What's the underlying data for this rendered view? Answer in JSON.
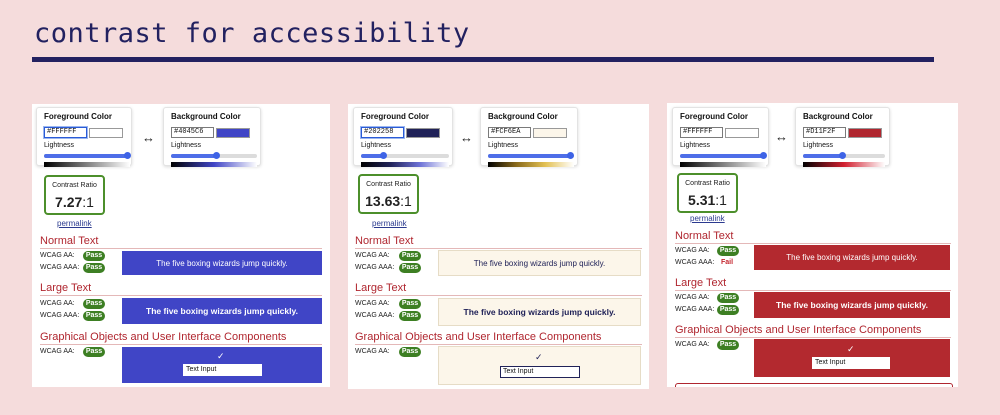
{
  "page": {
    "title": "contrast for accessibility"
  },
  "panels": [
    {
      "foreground": {
        "title": "Foreground Color",
        "hex": "#FFFFFF",
        "swatch": "#FFFFFF",
        "lightness_label": "Lightness",
        "lightness": 0.96
      },
      "background": {
        "title": "Background Color",
        "hex": "#4045C6",
        "swatch": "#4045C6",
        "lightness_label": "Lightness",
        "lightness": 0.52
      },
      "swap_symbol": "↔",
      "contrast": {
        "label": "Contrast Ratio",
        "value": "7.27",
        "suffix": ":1"
      },
      "permalink": "permalink",
      "normal": {
        "heading": "Normal Text",
        "aa_label": "WCAG AA:",
        "aa": "Pass",
        "aaa_label": "WCAG AAA:",
        "aaa": "Pass",
        "sample": "The five boxing wizards jump quickly."
      },
      "large": {
        "heading": "Large Text",
        "aa_label": "WCAG AA:",
        "aa": "Pass",
        "aaa_label": "WCAG AAA:",
        "aaa": "Pass",
        "sample": "The five boxing wizards jump quickly."
      },
      "graphics": {
        "heading": "Graphical Objects and User Interface Components",
        "aa_label": "WCAG AA:",
        "aa": "Pass",
        "check": "✓",
        "input_value": "Text Input"
      },
      "colors": {
        "sample_bg": "#4045C6",
        "sample_fg": "#FFFFFF",
        "input_border": "#FFFFFF",
        "grad_fg_start": "#FFFFFF",
        "grad_fg_end": "#000000"
      }
    },
    {
      "foreground": {
        "title": "Foreground Color",
        "hex": "#202258",
        "swatch": "#202258",
        "lightness_label": "Lightness",
        "lightness": 0.25
      },
      "background": {
        "title": "Background Color",
        "hex": "#FCF6EA",
        "swatch": "#FCF6EA",
        "lightness_label": "Lightness",
        "lightness": 0.95
      },
      "swap_symbol": "↔",
      "contrast": {
        "label": "Contrast Ratio",
        "value": "13.63",
        "suffix": ":1"
      },
      "permalink": "permalink",
      "normal": {
        "heading": "Normal Text",
        "aa_label": "WCAG AA:",
        "aa": "Pass",
        "aaa_label": "WCAG AAA:",
        "aaa": "Pass",
        "sample": "The five boxing wizards jump quickly."
      },
      "large": {
        "heading": "Large Text",
        "aa_label": "WCAG AA:",
        "aa": "Pass",
        "aaa_label": "WCAG AAA:",
        "aaa": "Pass",
        "sample": "The five boxing wizards jump quickly."
      },
      "graphics": {
        "heading": "Graphical Objects and User Interface Components",
        "aa_label": "WCAG AA:",
        "aa": "Pass",
        "check": "✓",
        "input_value": "Text Input"
      },
      "colors": {
        "sample_bg": "#FCF6EA",
        "sample_fg": "#202258",
        "input_border": "#202258"
      }
    },
    {
      "foreground": {
        "title": "Foreground Color",
        "hex": "#FFFFFF",
        "swatch": "#FFFFFF",
        "lightness_label": "Lightness",
        "lightness": 0.96
      },
      "background": {
        "title": "Background Color",
        "hex": "#D11F2F",
        "swatch": "#B0262F",
        "lightness_label": "Lightness",
        "lightness": 0.47
      },
      "swap_symbol": "↔",
      "contrast": {
        "label": "Contrast Ratio",
        "value": "5.31",
        "suffix": ":1"
      },
      "permalink": "permalink",
      "normal": {
        "heading": "Normal Text",
        "aa_label": "WCAG AA:",
        "aa": "Pass",
        "aaa_label": "WCAG AAA:",
        "aaa": "Fail",
        "sample": "The five boxing wizards jump quickly."
      },
      "large": {
        "heading": "Large Text",
        "aa_label": "WCAG AA:",
        "aa": "Pass",
        "aaa_label": "WCAG AAA:",
        "aaa": "Pass",
        "sample": "The five boxing wizards jump quickly."
      },
      "graphics": {
        "heading": "Graphical Objects and User Interface Components",
        "aa_label": "WCAG AA:",
        "aa": "Pass",
        "check": "✓",
        "input_value": "Text Input"
      },
      "colors": {
        "sample_bg": "#B3292F",
        "sample_fg": "#FFFFFF",
        "input_border": "#FFFFFF"
      }
    }
  ]
}
